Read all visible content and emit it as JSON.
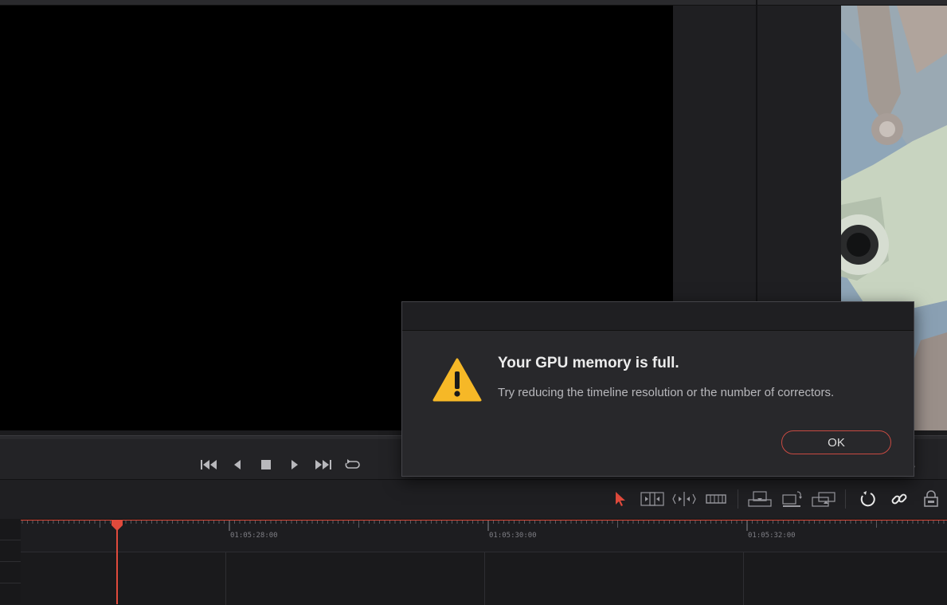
{
  "dialog": {
    "title": "Your GPU memory is full.",
    "message": "Try reducing the timeline resolution or the number of correctors.",
    "ok_label": "OK",
    "icon": "warning-icon"
  },
  "transport": {
    "buttons": [
      "skip-to-start-icon",
      "play-reverse-icon",
      "stop-icon",
      "play-icon",
      "skip-to-end-icon",
      "loop-icon"
    ]
  },
  "toolbar": {
    "tools": [
      "selection-arrow-icon",
      "trim-edit-icon",
      "dynamic-trim-icon",
      "blade-icon",
      "insert-clip-icon",
      "overwrite-clip-icon",
      "replace-clip-icon",
      "snapping-icon",
      "linked-selection-icon",
      "position-lock-icon"
    ]
  },
  "timeline": {
    "timecodes": [
      "01:05:28:00",
      "01:05:30:00",
      "01:05:32:00"
    ]
  },
  "colors": {
    "accent": "#e04a3c",
    "warning": "#f6b827",
    "dialog_bg": "#28282b",
    "ok_border": "#c84a42"
  }
}
